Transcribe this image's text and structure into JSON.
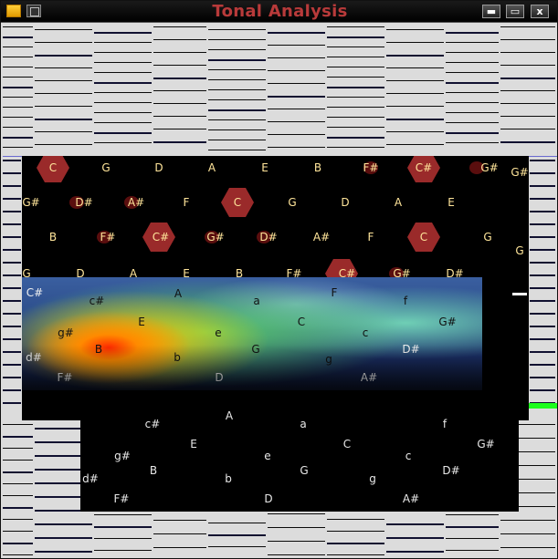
{
  "window": {
    "title": "Tonal Analysis",
    "controls": {
      "minimize_glyph": "▬",
      "maximize_glyph": "▭",
      "close_glyph": "x"
    }
  },
  "colors": {
    "title": "#b83a3a",
    "hex_active": "#9a2a2a",
    "green_indicator": "#1cff1c"
  },
  "major_grid": [
    [
      "C",
      "G",
      "D",
      "A",
      "E",
      "B",
      "F#",
      "C#",
      "G#",
      "G#"
    ],
    [
      "G#",
      "D#",
      "A#",
      "F",
      "C",
      "G",
      "D",
      "A",
      "E"
    ],
    [
      "B",
      "F#",
      "C#",
      "G#",
      "D#",
      "A#",
      "F",
      "C",
      "G",
      "G"
    ],
    [
      "G",
      "D",
      "A",
      "E",
      "B",
      "F#",
      "C#",
      "G#",
      "D#"
    ]
  ],
  "minor_grid_upper": [
    "C#",
    "c#",
    "A",
    "a",
    "F",
    "f"
  ],
  "heatmap": {
    "row1": [
      "g#",
      "E",
      "e",
      "C",
      "c",
      "G#"
    ],
    "row2": [
      "d#",
      "B",
      "b",
      "G",
      "g",
      "D#"
    ],
    "row3": [
      "F#",
      "D",
      "A#"
    ]
  },
  "lower_pane": {
    "row1": [
      "c#",
      "A",
      "a",
      "f"
    ],
    "row2": [
      "E",
      "C",
      "G#"
    ],
    "row3": [
      "g#",
      "e",
      "c"
    ],
    "row4": [
      "B",
      "b",
      "G",
      "D#"
    ],
    "row5": [
      "d#",
      "g"
    ],
    "row6": [
      "F#",
      "D",
      "A#"
    ]
  }
}
